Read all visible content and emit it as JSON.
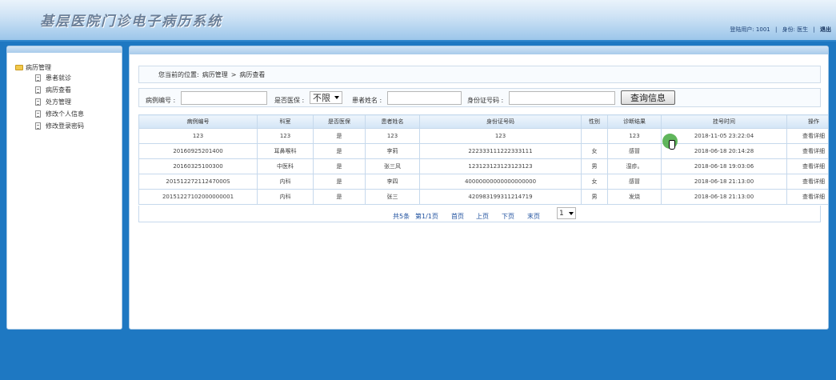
{
  "header": {
    "app_title": "基层医院门诊电子病历系统",
    "user_label": "登陆用户: 1001",
    "role_label": "身份: 医生",
    "logout": "退出",
    "sep": "|"
  },
  "sidebar": {
    "root_label": "病历管理",
    "items": [
      {
        "label": "患者就诊"
      },
      {
        "label": "病历查看"
      },
      {
        "label": "处方管理"
      },
      {
        "label": "修改个人信息"
      },
      {
        "label": "修改登录密码"
      }
    ]
  },
  "breadcrumb": {
    "prefix": "您当前的位置:",
    "level1": "病历管理",
    "sep": ">",
    "level2": "病历查看"
  },
  "search": {
    "case_no_label": "病例编号 :",
    "case_no_value": "",
    "insured_label": "是否医保 :",
    "insured_value": "不限",
    "name_label": "患者姓名 :",
    "name_value": "",
    "id_label": "身份证号码 :",
    "id_value": "",
    "query_button": "查询信息"
  },
  "table": {
    "columns": [
      "病例编号",
      "科室",
      "是否医保",
      "患者姓名",
      "身份证号码",
      "性别",
      "诊断结果",
      "挂号时间",
      "操作"
    ],
    "rows": [
      [
        "123",
        "123",
        "是",
        "123",
        "123",
        "",
        "123",
        "2018-11-05 23:22:04",
        "查看详细"
      ],
      [
        "20160925201400",
        "耳鼻喉科",
        "是",
        "李莉",
        "222333111222333111",
        "女",
        "感冒",
        "2018-06-18 20:14:28",
        "查看详细"
      ],
      [
        "20160325100300",
        "中医科",
        "是",
        "张三风",
        "123123123123123123",
        "男",
        "湿疹。",
        "2018-06-18 19:03:06",
        "查看详细"
      ],
      [
        "20151227211247000S",
        "内科",
        "是",
        "李四",
        "40000000000000000000",
        "女",
        "感冒",
        "2018-06-18 21:13:00",
        "查看详细"
      ],
      [
        "20151227102000000001",
        "内科",
        "是",
        "张三",
        "420983199311214719",
        "男",
        "发烧",
        "2018-06-18 21:13:00",
        "查看详细"
      ]
    ]
  },
  "pagination": {
    "total": "共5条",
    "page_of": "第1/1页",
    "first": "首页",
    "prev": "上页",
    "next": "下页",
    "last": "末页",
    "page_value": "1"
  },
  "colors": {
    "background": "#1e78c2",
    "link": "#1d4f9e"
  }
}
